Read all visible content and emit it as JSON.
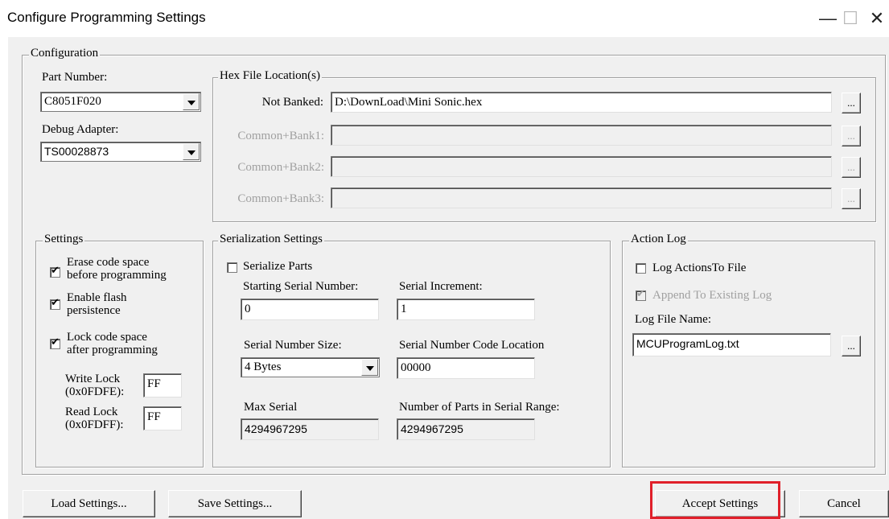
{
  "window": {
    "title": "Configure Programming Settings",
    "minimize": "—",
    "maximize": "☐",
    "close": "✕"
  },
  "configuration": {
    "legend": "Configuration",
    "part_number_label": "Part Number:",
    "part_number_value": "C8051F020",
    "debug_adapter_label": "Debug Adapter:",
    "debug_adapter_value": "TS00028873"
  },
  "hex": {
    "legend": "Hex File Location(s)",
    "rows": [
      {
        "label": "Not Banked:",
        "value": "D:\\DownLoad\\Mini Sonic.hex",
        "enabled": true
      },
      {
        "label": "Common+Bank1:",
        "value": "",
        "enabled": false
      },
      {
        "label": "Common+Bank2:",
        "value": "",
        "enabled": false
      },
      {
        "label": "Common+Bank3:",
        "value": "",
        "enabled": false
      }
    ],
    "browse": "..."
  },
  "settings": {
    "legend": "Settings",
    "erase_l1": "Erase code space",
    "erase_l2": "before programming",
    "flash_l1": "Enable flash",
    "flash_l2": "persistence",
    "lock_l1": "Lock code space",
    "lock_l2": "after programming",
    "write_lock_l1": "Write Lock",
    "write_lock_l2": "(0x0FDFE):",
    "write_lock_value": "FF",
    "read_lock_l1": "Read Lock",
    "read_lock_l2": "(0x0FDFF):",
    "read_lock_value": "FF"
  },
  "serialization": {
    "legend": "Serialization Settings",
    "serialize_label": "Serialize Parts",
    "start_label": "Starting Serial Number:",
    "start_value": "0",
    "incr_label": "Serial Increment:",
    "incr_value": "1",
    "size_label": "Serial Number Size:",
    "size_value": "4 Bytes",
    "code_loc_label": "Serial Number Code Location",
    "code_loc_value": "00000",
    "max_label": "Max Serial",
    "max_value": "4294967295",
    "parts_label": "Number of Parts in Serial Range:",
    "parts_value": "4294967295"
  },
  "action_log": {
    "legend": "Action Log",
    "log_label": "Log ActionsTo File",
    "append_label": "Append To Existing Log",
    "file_label": "Log File Name:",
    "file_value": "MCUProgramLog.txt",
    "browse": "..."
  },
  "buttons": {
    "load": "Load Settings...",
    "save": "Save Settings...",
    "accept": "Accept Settings",
    "cancel": "Cancel"
  },
  "colors": {
    "highlight": "#e0202a",
    "dialog": "#f0f0f0"
  }
}
